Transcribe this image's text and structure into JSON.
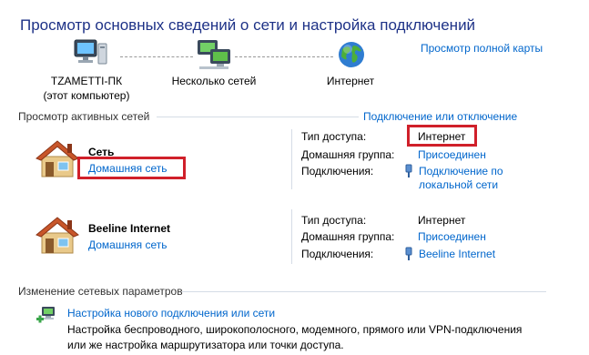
{
  "page": {
    "title": "Просмотр основных сведений о сети и настройка подключений",
    "full_map_link": "Просмотр полной карты"
  },
  "map": {
    "computer_name": "TZAMETTI-ПК",
    "computer_sub": "(этот компьютер)",
    "middle_label": "Несколько сетей",
    "internet_label": "Интернет"
  },
  "active": {
    "section_title": "Просмотр активных сетей",
    "connect_link": "Подключение или отключение",
    "networks": [
      {
        "name": "Сеть",
        "type_link": "Домашняя сеть",
        "access_label": "Тип доступа:",
        "access_value": "Интернет",
        "homegroup_label": "Домашняя группа:",
        "homegroup_value": "Присоединен",
        "connections_label": "Подключения:",
        "connection_line1": "Подключение по",
        "connection_line2": "локальной сети"
      },
      {
        "name": "Beeline Internet",
        "type_link": "Домашняя сеть",
        "access_label": "Тип доступа:",
        "access_value": "Интернет",
        "homegroup_label": "Домашняя группа:",
        "homegroup_value": "Присоединен",
        "connections_label": "Подключения:",
        "connection_line1": "Beeline Internet"
      }
    ]
  },
  "change": {
    "section_title": "Изменение сетевых параметров",
    "new_conn_link": "Настройка нового подключения или сети",
    "new_conn_desc1": "Настройка беспроводного, широкополосного, модемного, прямого или VPN-подключения",
    "new_conn_desc2": "или же настройка маршрутизатора или точки доступа."
  },
  "colors": {
    "link": "#0066cc",
    "title": "#1e3287",
    "highlight": "#d0202a"
  }
}
